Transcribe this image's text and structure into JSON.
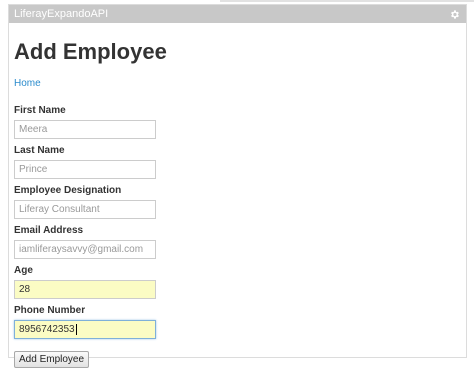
{
  "portlet": {
    "title": "LiferayExpandoAPI",
    "settings_icon": "gear-icon"
  },
  "page": {
    "heading": "Add Employee",
    "home_link": "Home"
  },
  "form": {
    "fields": [
      {
        "label": "First Name",
        "value": "Meera"
      },
      {
        "label": "Last Name",
        "value": "Prince"
      },
      {
        "label": "Employee Designation",
        "value": "Liferay Consultant"
      },
      {
        "label": "Email Address",
        "value": "iamliferaysavvy@gmail.com"
      },
      {
        "label": "Age",
        "value": "28"
      },
      {
        "label": "Phone Number",
        "value": "8956742353"
      }
    ],
    "submit_label": "Add Employee"
  },
  "colors": {
    "titlebar": "#c8c8c8",
    "link": "#2a8bcc",
    "autofill": "#fbfcc4"
  }
}
